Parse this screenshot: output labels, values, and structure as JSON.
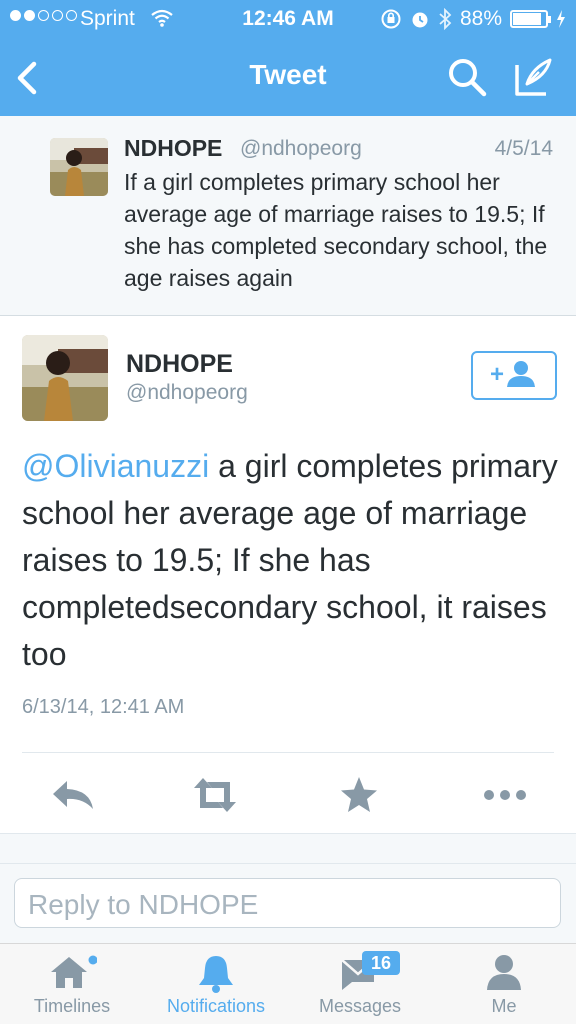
{
  "status_bar": {
    "carrier": "Sprint",
    "time": "12:46 AM",
    "battery": "88%",
    "battery_level": 0.88
  },
  "nav": {
    "title": "Tweet",
    "icons": [
      "back-chevron-icon",
      "search-icon",
      "compose-icon"
    ]
  },
  "parent_tweet": {
    "name": "NDHOPE",
    "handle": "@ndhopeorg",
    "date": "4/5/14",
    "text": "If a girl completes primary school her average age of marriage raises to 19.5; If she has completed secondary school, the age raises again"
  },
  "main_tweet": {
    "name": "NDHOPE",
    "handle": "@ndhopeorg",
    "mention": "@Olivianuzzi",
    "text": " a girl completes primary school her average age of marriage raises to 19.5; If she has completedsecondary school, it raises too",
    "timestamp": "6/13/14, 12:41 AM"
  },
  "actions": [
    "reply-icon",
    "retweet-icon",
    "favorite-icon",
    "more-icon"
  ],
  "reply": {
    "placeholder": "Reply to NDHOPE"
  },
  "tabs": [
    {
      "label": "Timelines",
      "icon": "home-icon"
    },
    {
      "label": "Notifications",
      "icon": "bell-icon",
      "active": true
    },
    {
      "label": "Messages",
      "icon": "messages-icon",
      "badge": "16"
    },
    {
      "label": "Me",
      "icon": "person-icon"
    }
  ],
  "colors": {
    "accent": "#55acee",
    "muted": "#8899a6",
    "text": "#292f33"
  }
}
